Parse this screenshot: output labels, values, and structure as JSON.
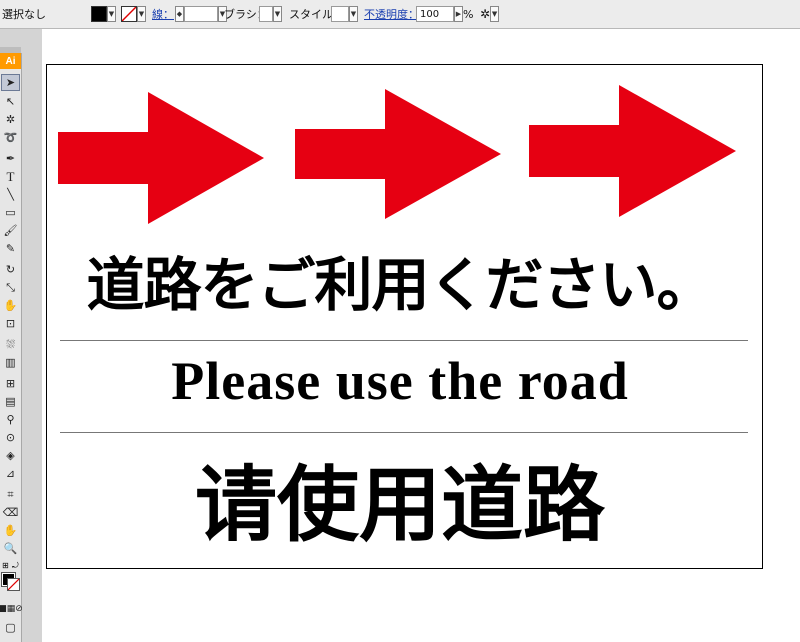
{
  "control_bar": {
    "selection_status": "選択なし",
    "stroke_label": "線：",
    "brush_label": "ブラシ：",
    "style_label": "スタイル：",
    "opacity_label": "不透明度：",
    "opacity_value": "100",
    "opacity_unit": "%",
    "fill_color": "#000000"
  },
  "app": {
    "logo": "Ai"
  },
  "tools": [
    "selection-tool",
    "direct-selection-tool",
    "magic-wand-tool",
    "lasso-tool",
    "pen-tool",
    "type-tool",
    "line-tool",
    "rectangle-tool",
    "paintbrush-tool",
    "pencil-tool",
    "rotate-tool",
    "scale-tool",
    "warp-tool",
    "free-transform-tool",
    "symbol-sprayer-tool",
    "graph-tool",
    "mesh-tool",
    "gradient-tool",
    "eyedropper-tool",
    "blend-tool",
    "live-paint-tool",
    "slice-tool",
    "eraser-tool",
    "hand-tool",
    "zoom-tool"
  ],
  "sign": {
    "japanese": "道路をご利用ください。",
    "english": "Please use the road",
    "chinese": "请使用道路",
    "arrow_color": "#e60012"
  }
}
